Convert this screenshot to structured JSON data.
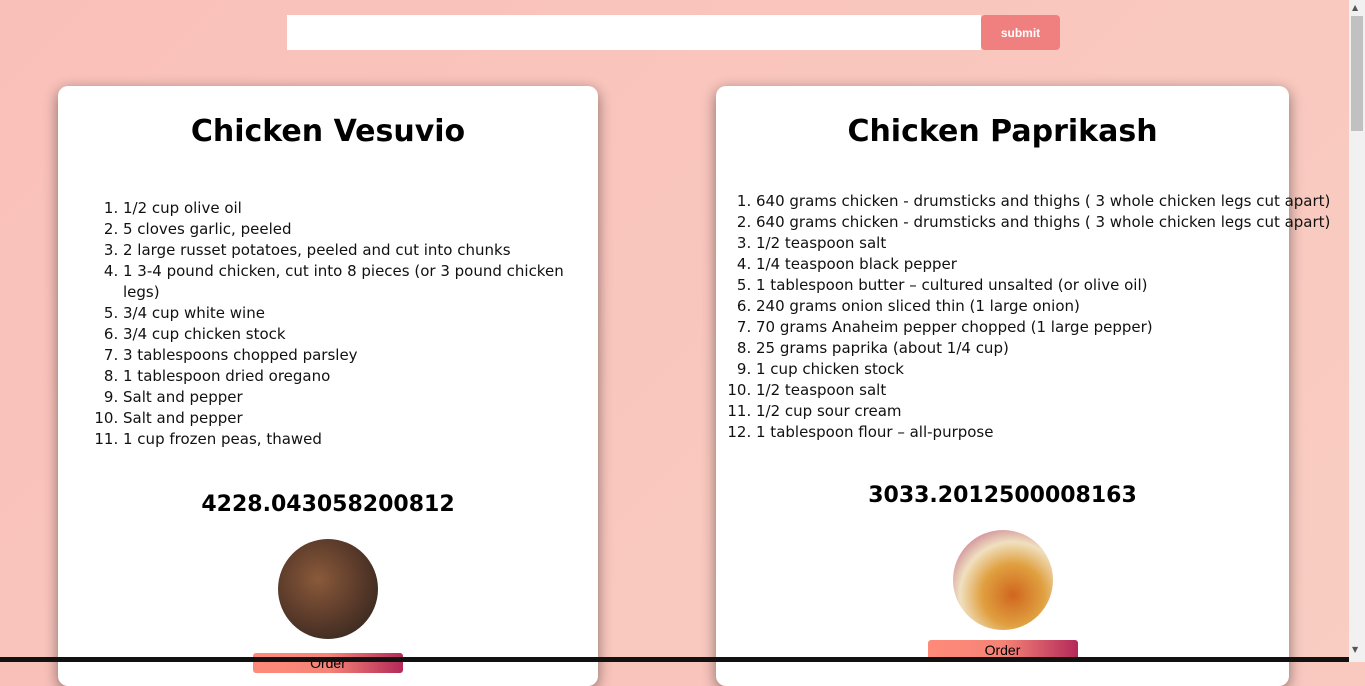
{
  "search": {
    "value": "",
    "submit_label": "submit"
  },
  "recipes": [
    {
      "title": "Chicken Vesuvio",
      "ingredients": [
        "1/2 cup olive oil",
        "5 cloves garlic, peeled",
        "2 large russet potatoes, peeled and cut into chunks",
        "1 3-4 pound chicken, cut into 8 pieces (or 3 pound chicken legs)",
        "3/4 cup white wine",
        "3/4 cup chicken stock",
        "3 tablespoons chopped parsley",
        "1 tablespoon dried oregano",
        "Salt and pepper",
        "Salt and pepper",
        "1 cup frozen peas, thawed"
      ],
      "price": "4228.043058200812",
      "order_label": "Order"
    },
    {
      "title": "Chicken Paprikash",
      "ingredients": [
        "640 grams chicken - drumsticks and thighs ( 3 whole chicken legs cut apart)",
        "640 grams chicken - drumsticks and thighs ( 3 whole chicken legs cut apart)",
        "1/2 teaspoon salt",
        "1/4 teaspoon black pepper",
        "1 tablespoon butter – cultured unsalted (or olive oil)",
        "240 grams onion sliced thin (1 large onion)",
        "70 grams Anaheim pepper chopped (1 large pepper)",
        "25 grams paprika (about 1/4 cup)",
        "1 cup chicken stock",
        "1/2 teaspoon salt",
        "1/2 cup sour cream",
        "1 tablespoon flour – all-purpose"
      ],
      "price": "3033.2012500008163",
      "order_label": "Order"
    }
  ]
}
